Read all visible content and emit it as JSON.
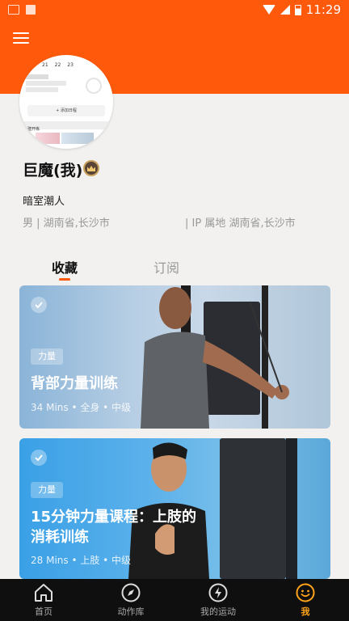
{
  "status_bar": {
    "time": "11:29"
  },
  "profile": {
    "name": "巨魔(我)",
    "bio": "暗室潮人",
    "info_left": "男 | 湖南省,长沙市",
    "info_right": "| IP 属地 湖南省,长沙市",
    "avatar_text": {
      "dates": [
        "21",
        "22",
        "23"
      ],
      "add_label": "+ 添加日程",
      "list_label": "建开练"
    }
  },
  "tabs": [
    {
      "label": "收藏",
      "active": true
    },
    {
      "label": "订阅",
      "active": false
    }
  ],
  "cards": [
    {
      "tag": "力量",
      "title": "背部力量训练",
      "meta": "34 Mins • 全身 • 中级"
    },
    {
      "tag": "力量",
      "title_line1": "15分钟力量课程：上肢的",
      "title_line2": "消耗训练",
      "meta": "28 Mins • 上肢 • 中级"
    }
  ],
  "bottom_nav": [
    {
      "label": "首页",
      "icon": "home-icon"
    },
    {
      "label": "动作库",
      "icon": "compass-icon"
    },
    {
      "label": "我的运动",
      "icon": "lightning-icon"
    },
    {
      "label": "我",
      "icon": "smile-icon",
      "active": true
    }
  ],
  "colors": {
    "accent": "#ff5a0b",
    "nav_active": "#ffa31a"
  }
}
